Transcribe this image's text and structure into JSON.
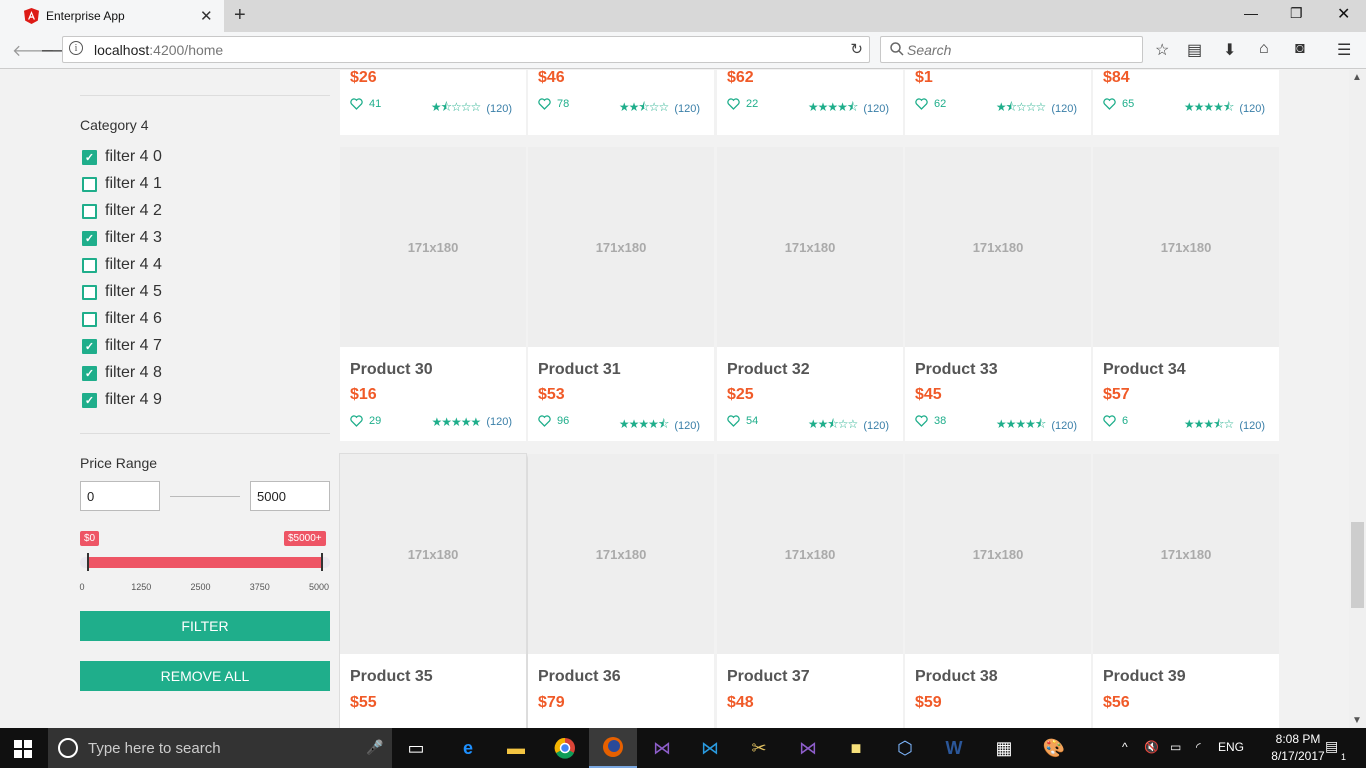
{
  "browser": {
    "tab_title": "Enterprise App",
    "url_host": "localhost",
    "url_rest": ":4200/home",
    "search_placeholder": "Search"
  },
  "sidebar": {
    "category_title": "Category 4",
    "filters": [
      {
        "label": "filter 4 0",
        "checked": true
      },
      {
        "label": "filter 4 1",
        "checked": false
      },
      {
        "label": "filter 4 2",
        "checked": false
      },
      {
        "label": "filter 4 3",
        "checked": true
      },
      {
        "label": "filter 4 4",
        "checked": false
      },
      {
        "label": "filter 4 5",
        "checked": false
      },
      {
        "label": "filter 4 6",
        "checked": false
      },
      {
        "label": "filter 4 7",
        "checked": true
      },
      {
        "label": "filter 4 8",
        "checked": true
      },
      {
        "label": "filter 4 9",
        "checked": true
      }
    ],
    "price_title": "Price Range",
    "price_min": "0",
    "price_max": "5000",
    "slider_min_badge": "$0",
    "slider_max_badge": "$5000+",
    "slider_ticks": [
      "0",
      "1250",
      "2500",
      "3750",
      "5000"
    ],
    "slider_range": [
      0,
      5000
    ],
    "filter_button": "FILTER",
    "remove_all_button": "REMOVE ALL"
  },
  "products": {
    "placeholder_text": "171x180",
    "reviews_text": "(120)",
    "top_row": [
      {
        "price": "$26",
        "likes": "41",
        "rating": 1.5
      },
      {
        "price": "$46",
        "likes": "78",
        "rating": 2.5
      },
      {
        "price": "$62",
        "likes": "22",
        "rating": 4.5
      },
      {
        "price": "$1",
        "likes": "62",
        "rating": 1.5
      },
      {
        "price": "$84",
        "likes": "65",
        "rating": 4.5
      }
    ],
    "middle_row": [
      {
        "name": "Product 30",
        "price": "$16",
        "likes": "29",
        "rating": 5
      },
      {
        "name": "Product 31",
        "price": "$53",
        "likes": "96",
        "rating": 4.5
      },
      {
        "name": "Product 32",
        "price": "$25",
        "likes": "54",
        "rating": 2.5
      },
      {
        "name": "Product 33",
        "price": "$45",
        "likes": "38",
        "rating": 4.5
      },
      {
        "name": "Product 34",
        "price": "$57",
        "likes": "6",
        "rating": 3.5
      }
    ],
    "bottom_row": [
      {
        "name": "Product 35",
        "price": "$55"
      },
      {
        "name": "Product 36",
        "price": "$79"
      },
      {
        "name": "Product 37",
        "price": "$48"
      },
      {
        "name": "Product 38",
        "price": "$59"
      },
      {
        "name": "Product 39",
        "price": "$56"
      }
    ]
  },
  "taskbar": {
    "search_placeholder": "Type here to search",
    "language": "ENG",
    "time": "8:08 PM",
    "date": "8/17/2017",
    "notification_count": "1"
  },
  "colors": {
    "accent": "#1fae8b",
    "price": "#f05a28",
    "slider": "#ee5565"
  }
}
